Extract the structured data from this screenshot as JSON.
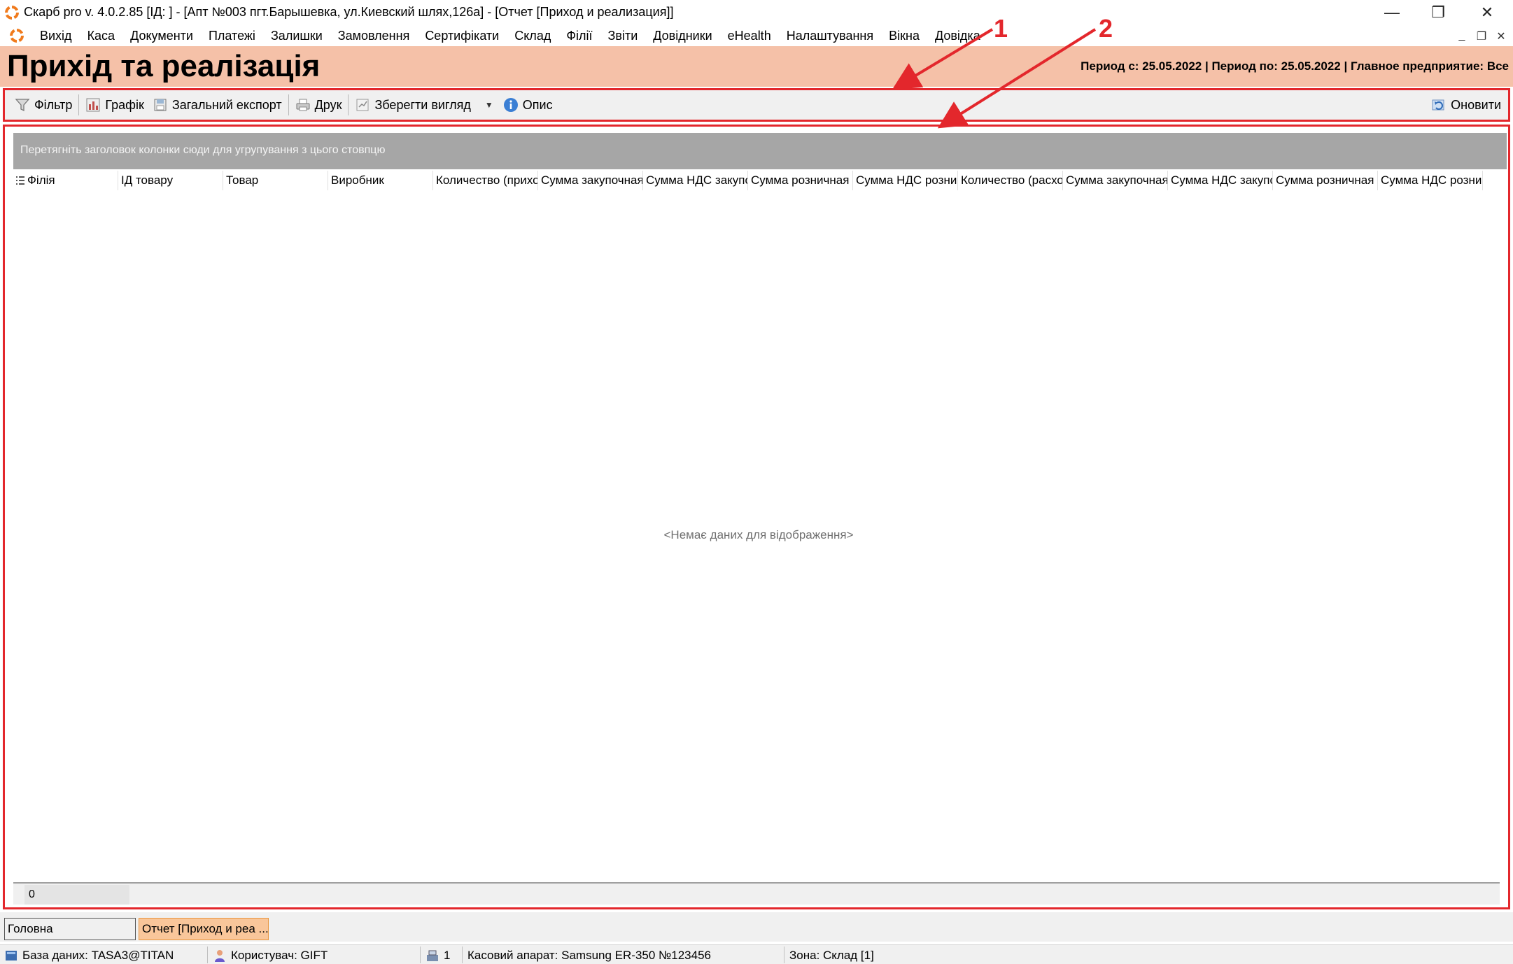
{
  "window": {
    "title": "Скарб pro v. 4.0.2.85 [ІД:        ] - [Апт №003 пгт.Барышевка, ул.Киевский шлях,126а] - [Отчет [Приход и реализация]]",
    "minimize_glyph": "—",
    "restore_glyph": "❐",
    "close_glyph": "✕"
  },
  "menu": {
    "items": [
      "Вихід",
      "Каса",
      "Документи",
      "Платежі",
      "Залишки",
      "Замовлення",
      "Сертифікати",
      "Склад",
      "Філії",
      "Звіти",
      "Довідники",
      "eHealth",
      "Налаштування",
      "Вікна",
      "Довідка"
    ],
    "mdi_min": "_",
    "mdi_restore": "❐",
    "mdi_close": "✕"
  },
  "header": {
    "title": "Прихід та реалізація",
    "period": "Период с: 25.05.2022 | Период по: 25.05.2022 | Главное предприятие: Все"
  },
  "toolbar": {
    "filter": "Фільтр",
    "chart": "Графік",
    "export": "Загальний експорт",
    "print": "Друк",
    "save_view": "Зберегти вигляд",
    "description": "Опис",
    "refresh": "Оновити"
  },
  "grid": {
    "group_hint": "Перетягніть заголовок колонки сюди для угрупування з цього стовпцю",
    "columns": [
      "Філія",
      "ІД товару",
      "Товар",
      "Виробник",
      "Количество (прихо",
      "Сумма закупочная",
      "Сумма НДС закупо",
      "Сумма розничная (",
      "Сумма НДС рознич",
      "Количество (расхо",
      "Сумма закупочная",
      "Сумма НДС закупо",
      "Сумма розничная (",
      "Сумма НДС рознич"
    ],
    "no_data": "<Немає даних для відображення>",
    "footer_count": "0"
  },
  "tabs": {
    "main": "Головна",
    "report": "Отчет [Приход и реа ..."
  },
  "status": {
    "database": "База даних: TASA3@TITAN",
    "user": "Користувач: GIFT",
    "register_count": "1",
    "cash_register": "Касовий апарат: Samsung ER-350 №123456",
    "zone": "Зона: Склад [1]"
  },
  "annotations": {
    "label_1": "1",
    "label_2": "2",
    "color": "#e3272c"
  },
  "colors": {
    "header_bg": "#f5c1a8",
    "group_panel_bg": "#a6a6a6",
    "active_tab_bg": "#f9c69a",
    "annotation_red": "#e3272c"
  }
}
